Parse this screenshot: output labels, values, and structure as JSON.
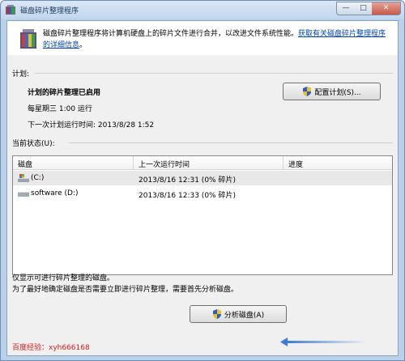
{
  "window": {
    "title": "磁盘碎片整理程序",
    "controls": {
      "minimize": "—",
      "maximize": "□",
      "close": "✕"
    }
  },
  "header": {
    "description": "磁盘碎片整理程序将计算机硬盘上的碎片文件进行合并，以改进文件系统性能。",
    "link_text": "获取有关磁盘碎片整理程序的详细信息",
    "link_suffix": "。"
  },
  "schedule": {
    "section_label": "计划:",
    "state": "计划的碎片整理已启用",
    "frequency": "每星期三 1:00 运行",
    "next_run": "下一次计划运行时间: 2013/8/28 1:52",
    "configure_button": "配置计划(S)..."
  },
  "status": {
    "section_label": "当前状态(U):",
    "columns": [
      "磁盘",
      "上一次运行时间",
      "进度"
    ],
    "rows": [
      {
        "disk": "(C:)",
        "last_run": "2013/8/16 12:31 (0% 碎片)",
        "progress": ""
      },
      {
        "disk": "software (D:)",
        "last_run": "2013/8/16 12:33 (0% 碎片)",
        "progress": ""
      }
    ]
  },
  "notes": {
    "line1": "仅显示可进行碎片整理的磁盘。",
    "line2": "为了最好地确定磁盘是否需要立即进行碎片整理，需要首先分析磁盘。"
  },
  "actions": {
    "analyze_button": "分析磁盘(A)"
  },
  "watermark": {
    "text": "百度经验：xyh666168"
  },
  "colors": {
    "link": "#0645ad",
    "watermark": "#d41c1c",
    "title_bar": "#c2d6ed"
  }
}
